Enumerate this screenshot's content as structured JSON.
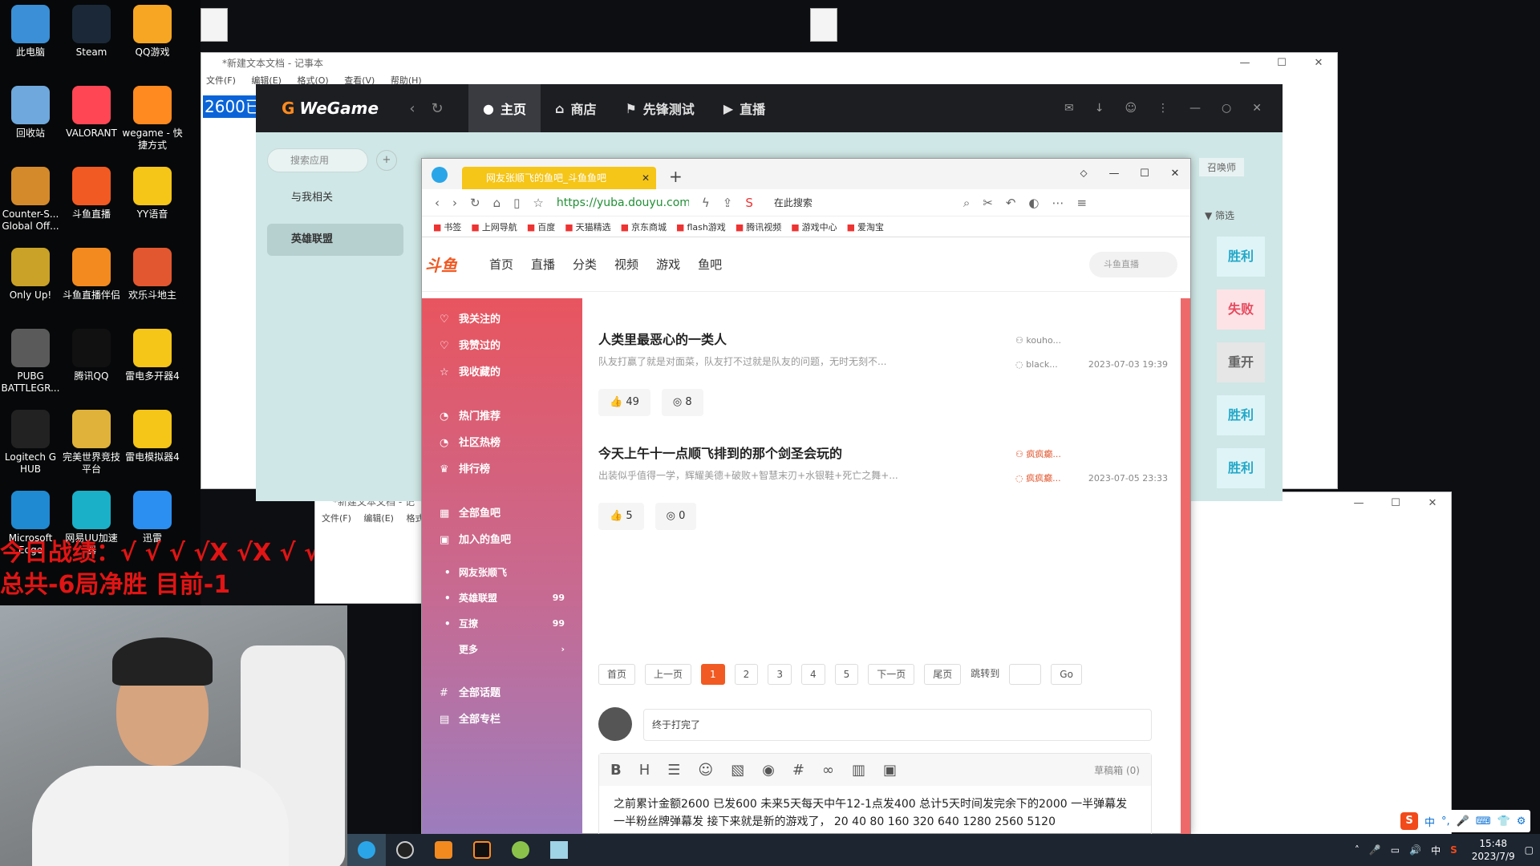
{
  "desktop": {
    "icons": [
      {
        "label": "此电脑",
        "icon": "computer-icon",
        "color": "#3b8fd6"
      },
      {
        "label": "Steam",
        "icon": "steam-icon",
        "color": "#1b2838"
      },
      {
        "label": "QQ游戏",
        "icon": "qqgame-icon",
        "color": "#f6a623"
      },
      {
        "label": "回收站",
        "icon": "recycle-bin-icon",
        "color": "#6fa8dc"
      },
      {
        "label": "VALORANT",
        "icon": "valorant-icon",
        "color": "#ff4655"
      },
      {
        "label": "wegame - 快捷方式",
        "icon": "wegame-icon",
        "color": "#ff8a1f"
      },
      {
        "label": "Counter-S... Global Off...",
        "icon": "csgo-icon",
        "color": "#d48a2a"
      },
      {
        "label": "斗鱼直播",
        "icon": "douyu-icon",
        "color": "#f15a22"
      },
      {
        "label": "YY语音",
        "icon": "yy-icon",
        "color": "#f5c518"
      },
      {
        "label": "Only Up!",
        "icon": "onlyup-icon",
        "color": "#c9a227"
      },
      {
        "label": "斗鱼直播伴侣",
        "icon": "douyu-companion-icon",
        "color": "#f28a1f"
      },
      {
        "label": "欢乐斗地主",
        "icon": "doudizhu-icon",
        "color": "#e2572f"
      },
      {
        "label": "PUBG BATTLEGR...",
        "icon": "pubg-icon",
        "color": "#5a5a5a"
      },
      {
        "label": "腾讯QQ",
        "icon": "qq-icon",
        "color": "#111111"
      },
      {
        "label": "雷电多开器4",
        "icon": "ldmulti-icon",
        "color": "#f5c518"
      },
      {
        "label": "Logitech G HUB",
        "icon": "logitech-icon",
        "color": "#222222"
      },
      {
        "label": "完美世界竞技平台",
        "icon": "perfectworld-icon",
        "color": "#e0b23a"
      },
      {
        "label": "雷电模拟器4",
        "icon": "ldplayer-icon",
        "color": "#f5c518"
      },
      {
        "label": "Microsoft Edge",
        "icon": "edge-icon",
        "color": "#1f8ad2"
      },
      {
        "label": "网易UU加速器",
        "icon": "uu-icon",
        "color": "#1ab0c8"
      },
      {
        "label": "迅雷",
        "icon": "xunlei-icon",
        "color": "#2b8ff2"
      }
    ],
    "top_files": [
      "",
      ""
    ],
    "overlay": {
      "line1": "今日战绩：√ √ √ √X √X √ √",
      "line2": "总共-6局净胜  目前-1"
    }
  },
  "notepad_back": {
    "title": "*新建文本文档 - 记事本",
    "menu": [
      "文件(F)",
      "编辑(E)",
      "格式(O)",
      "查看(V)",
      "帮助(H)"
    ],
    "selected_text": "2600已"
  },
  "notepad_small": {
    "title": "*新建文本文档 - 记",
    "menu": [
      "文件(F)",
      "编辑(E)",
      "格式"
    ]
  },
  "wegame": {
    "logo": "WeGame",
    "tabs": [
      "主页",
      "商店",
      "先锋测试",
      "直播"
    ],
    "search_placeholder": "搜索应用",
    "side_items": [
      "与我相关",
      "英雄联盟"
    ],
    "summoner_label": "召唤师",
    "filter_label": "筛选",
    "results": [
      {
        "label": "胜利",
        "kind": "win"
      },
      {
        "label": "失败",
        "kind": "lose"
      },
      {
        "label": "重开",
        "kind": "re"
      },
      {
        "label": "胜利",
        "kind": "win"
      },
      {
        "label": "胜利",
        "kind": "win"
      }
    ]
  },
  "browser": {
    "tab_title": "网友张顺飞的鱼吧_斗鱼鱼吧",
    "url": "https://yuba.douyu.com",
    "search_placeholder": "在此搜索",
    "bookmarks": [
      "书签",
      "上网导航",
      "百度",
      "天猫精选",
      "京东商城",
      "flash游戏",
      "腾讯视频",
      "游戏中心",
      "爱淘宝"
    ]
  },
  "douyu": {
    "logo": "斗鱼",
    "nav": [
      "首页",
      "直播",
      "分类",
      "视频",
      "游戏",
      "鱼吧"
    ],
    "search_placeholder": "斗鱼直播",
    "side_group1": [
      "我关注的",
      "我赞过的",
      "我收藏的"
    ],
    "side_group2": [
      "热门推荐",
      "社区热榜",
      "排行榜"
    ],
    "side_group3": [
      "全部鱼吧",
      "加入的鱼吧"
    ],
    "side_sub": [
      {
        "label": "网友张顺飞",
        "count": ""
      },
      {
        "label": "英雄联盟",
        "count": "99"
      },
      {
        "label": "互撩",
        "count": "99"
      }
    ],
    "side_more": "更多",
    "side_group4": [
      "全部话题",
      "全部专栏"
    ],
    "posts": [
      {
        "title": "人类里最恶心的一类人",
        "excerpt": "队友打赢了就是对面菜，队友打不过就是队友的问题，无时无刻不...",
        "author": "kouho...",
        "replier": "black...",
        "date": "2023-07-03 19:39",
        "likes": "49",
        "comments": "8"
      },
      {
        "title": "今天上午十一点顺飞排到的那个剑圣会玩的",
        "excerpt": "出装似乎值得一学，辉耀美德+破败+智慧末刃+水银鞋+死亡之舞+...",
        "author": "疯疯癫...",
        "replier": "疯疯癫...",
        "date": "2023-07-05 23:33",
        "likes": "5",
        "comments": "0"
      }
    ],
    "pager": {
      "first": "首页",
      "prev": "上一页",
      "pages": [
        "1",
        "2",
        "3",
        "4",
        "5"
      ],
      "next": "下一页",
      "last": "尾页",
      "jump": "跳转到",
      "go": "Go"
    },
    "reply_text": "终于打完了",
    "drafts": "草稿箱 (0)",
    "editor_text": "之前累计金额2600 已发600 未来5天每天中午12-1点发400 总计5天时间发完余下的2000 一半弹幕发一半粉丝牌弹幕发 接下来就是新的游戏了， 20 40 80 160 320 640 1280 2560 5120"
  },
  "taskbar": {
    "apps": [
      "edge-icon",
      "obs-icon",
      "douyu-icon",
      "wegame-icon",
      "lol-icon",
      "notepad-icon"
    ],
    "ime": [
      "中",
      "°,",
      "🎤",
      "⌨",
      "👕",
      "⚙"
    ],
    "tray_lang": "中",
    "time": "15:48",
    "date": "2023/7/9"
  }
}
